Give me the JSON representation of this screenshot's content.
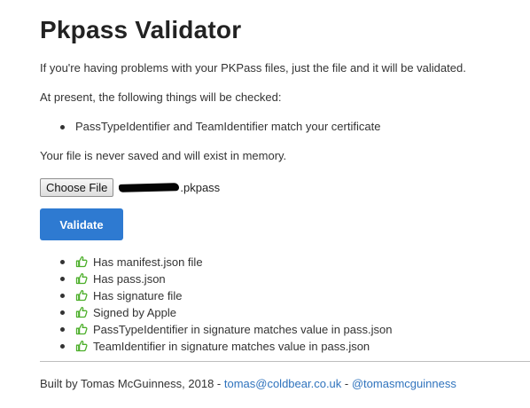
{
  "header": {
    "title": "Pkpass Validator"
  },
  "intro": {
    "line1": "If you're having problems with your PKPass files, just the file and it will be validated.",
    "line2": "At present, the following things will be checked:",
    "checks": [
      "PassTypeIdentifier and TeamIdentifier match your certificate"
    ],
    "line3": "Your file is never saved and will exist in memory."
  },
  "upload": {
    "choose_label": "Choose File",
    "file_suffix": ".pkpass"
  },
  "actions": {
    "validate_label": "Validate"
  },
  "results": [
    {
      "label": "Has manifest.json file",
      "icon": "thumbs-up-icon"
    },
    {
      "label": "Has pass.json",
      "icon": "thumbs-up-icon"
    },
    {
      "label": "Has signature file",
      "icon": "thumbs-up-icon"
    },
    {
      "label": "Signed by Apple",
      "icon": "thumbs-up-icon"
    },
    {
      "label": "PassTypeIdentifier in signature matches value in pass.json",
      "icon": "thumbs-up-icon"
    },
    {
      "label": "TeamIdentifier in signature matches value in pass.json",
      "icon": "thumbs-up-icon"
    }
  ],
  "footer": {
    "prefix": "Built by Tomas McGuinness, 2018 - ",
    "email": "tomas@coldbear.co.uk",
    "separator": " - ",
    "twitter": "@tomasmcguinness"
  },
  "colors": {
    "accent": "#2e7ad1",
    "link": "#2f73bd",
    "success": "#4caf2a",
    "text": "#333333"
  }
}
